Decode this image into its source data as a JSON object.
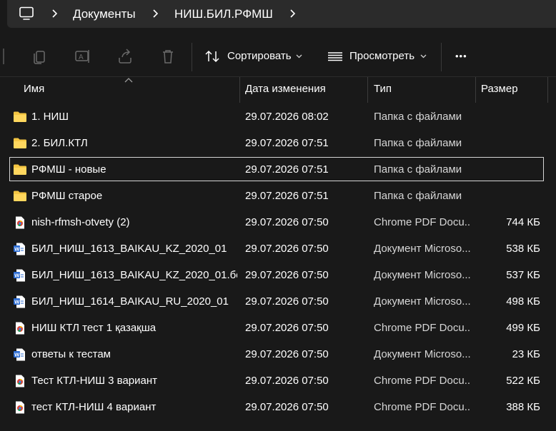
{
  "address": {
    "segments": [
      "Документы",
      "НИШ.БИЛ.РФМШ"
    ]
  },
  "toolbar": {
    "sort_label": "Сортировать",
    "view_label": "Просмотреть",
    "more_label": "•••"
  },
  "columns": {
    "name": "Имя",
    "date": "Дата изменения",
    "type": "Тип",
    "size": "Размер"
  },
  "files": [
    {
      "name": "1. НИШ",
      "date": "29.07.2026 08:02",
      "type": "Папка с файлами",
      "size": "",
      "icon": "folder-icon"
    },
    {
      "name": "2. БИЛ.КТЛ",
      "date": "29.07.2026 07:51",
      "type": "Папка с файлами",
      "size": "",
      "icon": "folder-icon"
    },
    {
      "name": "РФМШ - новые",
      "date": "29.07.2026 07:51",
      "type": "Папка с файлами",
      "size": "",
      "icon": "folder-icon",
      "selected": true
    },
    {
      "name": "РФМШ старое",
      "date": "29.07.2026 07:51",
      "type": "Папка с файлами",
      "size": "",
      "icon": "folder-icon"
    },
    {
      "name": "nish-rfmsh-otvety (2)",
      "date": "29.07.2026 07:50",
      "type": "Chrome PDF Docu...",
      "size": "744 КБ",
      "icon": "chrome-pdf-icon"
    },
    {
      "name": "БИЛ_НИШ_1613_BAIKAU_KZ_2020_01",
      "date": "29.07.2026 07:50",
      "type": "Документ Microso...",
      "size": "538 КБ",
      "icon": "word-doc-icon"
    },
    {
      "name": "БИЛ_НИШ_1613_BAIKAU_KZ_2020_01.бе...",
      "date": "29.07.2026 07:50",
      "type": "Документ Microso...",
      "size": "537 КБ",
      "icon": "word-doc-icon"
    },
    {
      "name": "БИЛ_НИШ_1614_BAIKAU_RU_2020_01",
      "date": "29.07.2026 07:50",
      "type": "Документ Microso...",
      "size": "498 КБ",
      "icon": "word-doc-icon"
    },
    {
      "name": "НИШ КТЛ тест 1 қазақша",
      "date": "29.07.2026 07:50",
      "type": "Chrome PDF Docu...",
      "size": "499 КБ",
      "icon": "chrome-pdf-icon"
    },
    {
      "name": "ответы к тестам",
      "date": "29.07.2026 07:50",
      "type": "Документ Microso...",
      "size": "23 КБ",
      "icon": "word-doc-icon"
    },
    {
      "name": "Тест КТЛ-НИШ 3 вариант",
      "date": "29.07.2026 07:50",
      "type": "Chrome PDF Docu...",
      "size": "522 КБ",
      "icon": "chrome-pdf-icon"
    },
    {
      "name": "тест КТЛ-НИШ 4 вариант",
      "date": "29.07.2026 07:50",
      "type": "Chrome PDF Docu...",
      "size": "388 КБ",
      "icon": "chrome-pdf-icon"
    }
  ],
  "colors": {
    "background": "#191919",
    "address_bar": "#2b2b2b",
    "folder_yellow": "#f4c542",
    "word_blue": "#2b6cd4",
    "selection_border": "#d6d6d6"
  }
}
